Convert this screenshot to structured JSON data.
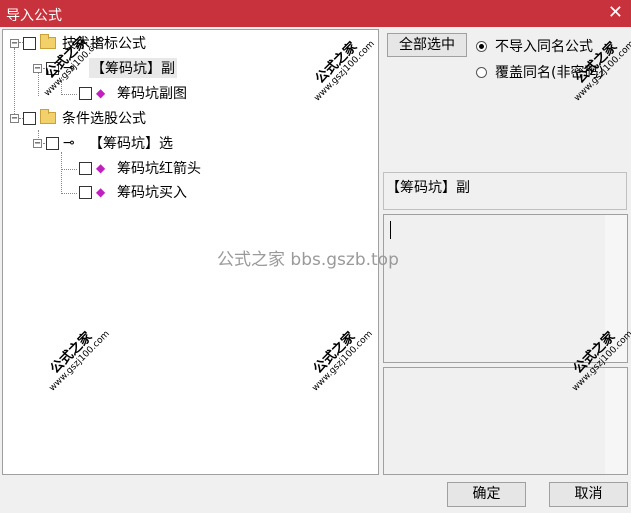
{
  "window": {
    "title": "导入公式",
    "close_glyph": "✕"
  },
  "tree": {
    "nodes": [
      {
        "label": "技术指标公式",
        "toggle": "−",
        "icon": "folder-icon"
      },
      {
        "label": "【筹码坑】副",
        "toggle": "−",
        "icon": "key-icon"
      },
      {
        "label": "筹码坑副图",
        "icon": "gem-icon"
      },
      {
        "label": "条件选股公式",
        "toggle": "−",
        "icon": "folder-icon"
      },
      {
        "label": "【筹码坑】选",
        "toggle": "−",
        "icon": "key-icon"
      },
      {
        "label": "筹码坑红箭头",
        "icon": "gem-icon"
      },
      {
        "label": "筹码坑买入",
        "icon": "gem-icon"
      }
    ]
  },
  "options": {
    "select_all_label": "全部选中",
    "radio_skip_label": "不导入同名公式",
    "radio_overwrite_label": "覆盖同名(非密码)",
    "selected": "skip"
  },
  "detail": {
    "formula_name": "【筹码坑】副"
  },
  "footer": {
    "ok_label": "确定",
    "cancel_label": "取消"
  },
  "watermark": {
    "stamp_text": "公式之家",
    "stamp_url": "www.gszj100.com",
    "center_text": "公式之家 bbs.gszb.top"
  },
  "icon_glyphs": {
    "key": "⊸",
    "gem": "◆"
  },
  "colors": {
    "titlebar": "#c8323c",
    "gem": "#c020c0",
    "folder": "#f2d16b"
  }
}
